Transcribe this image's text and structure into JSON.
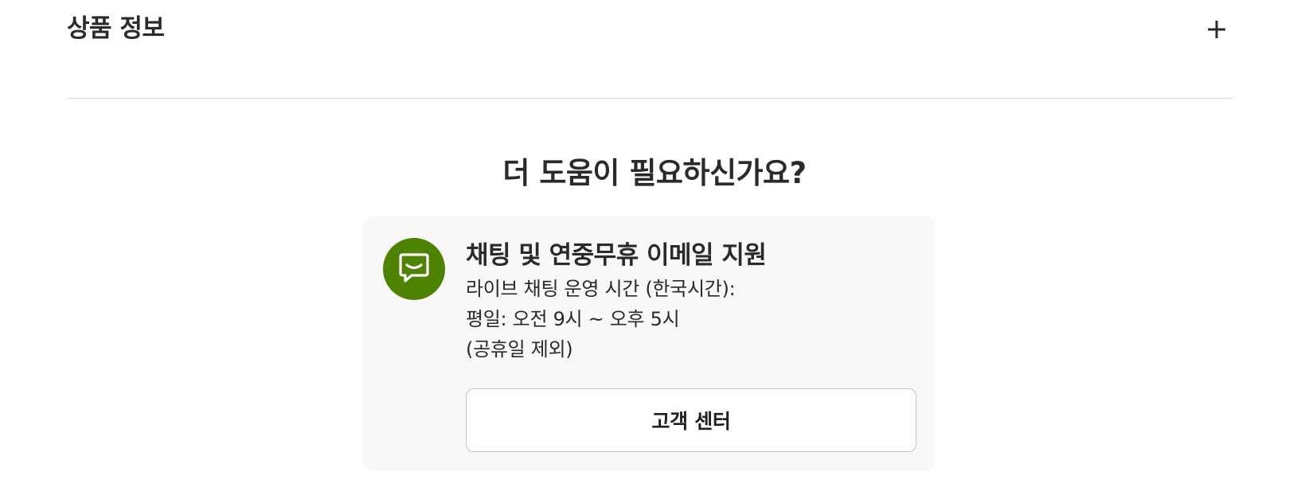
{
  "accordion": {
    "title": "상품 정보",
    "toggle_icon": "plus-icon"
  },
  "help": {
    "title": "더 도움이 필요하신가요?",
    "card": {
      "icon": "chat-bubble-icon",
      "icon_color": "#4d8300",
      "title": "채팅 및 연중무휴 이메일 지원",
      "lines": [
        "라이브 채팅 운영 시간 (한국시간):",
        "평일: 오전 9시 ~ 오후 5시",
        "(공휴일 제외)"
      ],
      "button_label": "고객 센터"
    }
  }
}
